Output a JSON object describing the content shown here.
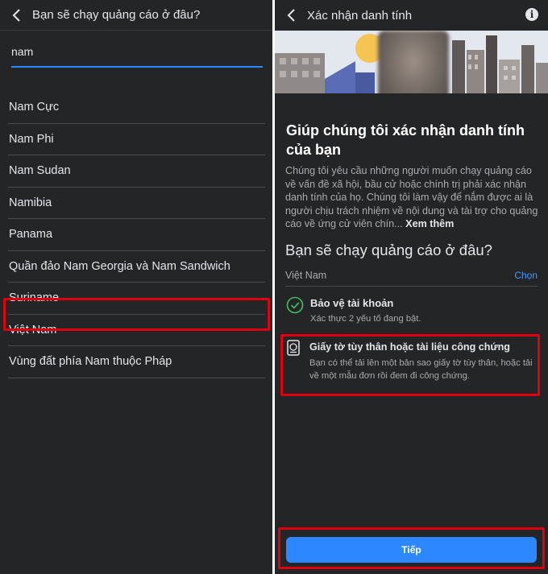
{
  "left_screen": {
    "title": "Bạn sẽ chạy quảng cáo ở đâu?",
    "search": {
      "value": "nam",
      "placeholder": ""
    },
    "countries": [
      "Nam Cực",
      "Nam Phi",
      "Nam Sudan",
      "Namibia",
      "Panama",
      "Quần đảo Nam Georgia và Nam Sandwich",
      "Suriname",
      "Việt Nam",
      "Vùng đất phía Nam thuộc Pháp"
    ]
  },
  "right_screen": {
    "title": "Xác nhận danh tính",
    "heading": "Giúp chúng tôi xác nhận danh tính của bạn",
    "body": "Chúng tôi yêu cầu những người muốn chạy quảng cáo về vấn đề xã hội, bầu cử hoặc chính trị phải xác nhận danh tính của họ. Chúng tôi làm vậy để nắm được ai là người chịu trách nhiệm về nội dung và tài trợ cho quảng cáo về ứng cử viên chín...",
    "see_more": "Xem thêm",
    "where_title": "Bạn sẽ chạy quảng cáo ở đâu?",
    "selected_country": "Việt Nam",
    "choose_label": "Chọn",
    "requirements": {
      "account": {
        "title": "Bảo vệ tài khoản",
        "desc": "Xác thực 2 yếu tố đang bật."
      },
      "document": {
        "title": "Giấy tờ tùy thân hoặc tài liệu công chứng",
        "desc": "Bạn có thể tải lên một bản sao giấy tờ tùy thân, hoặc tải về một mẫu đơn rồi đem đi công chứng."
      }
    },
    "next_label": "Tiếp"
  },
  "colors": {
    "background": "#242526",
    "accent": "#2d88ff",
    "highlight": "#e0000f",
    "success": "#45bd62"
  },
  "icons": [
    "back-arrow-icon",
    "info-icon",
    "check-circle-icon",
    "id-document-icon"
  ]
}
